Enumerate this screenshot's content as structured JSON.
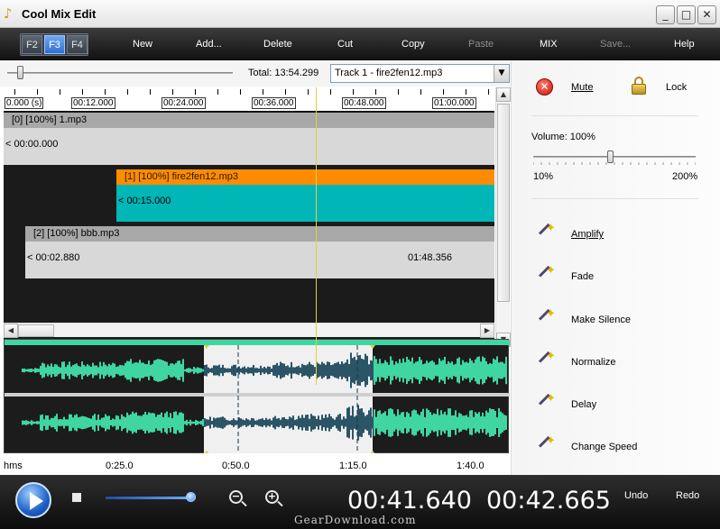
{
  "window": {
    "title": "Cool Mix Edit",
    "minimize": "_",
    "maximize": "□",
    "close": "✕"
  },
  "fkeys": [
    "F2",
    "F3",
    "F4"
  ],
  "menu": {
    "new": "New",
    "add": "Add...",
    "delete": "Delete",
    "cut": "Cut",
    "copy": "Copy",
    "paste": "Paste",
    "mix": "MIX",
    "save": "Save...",
    "help": "Help"
  },
  "toolbar": {
    "total": "Total: 13:54.299",
    "track_select": "Track 1 - fire2fen12.mp3"
  },
  "ruler": [
    "0.000 (s)",
    "00:12.000",
    "00:24.000",
    "00:36.000",
    "00:48.000",
    "01:00.000"
  ],
  "tracks": [
    {
      "header": "[0] [100%] 1.mp3",
      "start": "< 00:00.000",
      "end": ""
    },
    {
      "header": "[1] [100%] fire2fen12.mp3",
      "start": "< 00:15.000",
      "end": ""
    },
    {
      "header": "[2] [100%] bbb.mp3",
      "start": "< 00:02.880",
      "end": "01:48.356"
    }
  ],
  "wave_ruler": [
    "hms",
    "0:25.0",
    "0:50.0",
    "1:15.0",
    "1:40.0"
  ],
  "right_panel": {
    "mute": "Mute",
    "lock": "Lock",
    "volume": "Volume: 100%",
    "volume_min": "10%",
    "volume_max": "200%",
    "volume_level_percent": 100,
    "effects": [
      "Amplify",
      "Fade",
      "Make Silence",
      "Normalize",
      "Delay",
      "Change Speed"
    ]
  },
  "transport": {
    "current_time": "00:41.640",
    "end_time": "00:42.665",
    "undo": "Undo",
    "redo": "Redo",
    "zoom_out": "−",
    "zoom_in": "+"
  },
  "watermark": "GearDownload.com",
  "colors": {
    "selected_track_header": "#ff8c00",
    "selected_track_body": "#00b6b6",
    "waveform": "#3fd6a2",
    "playhead": "#e0d040"
  },
  "icons": [
    "mute-icon",
    "lock-icon",
    "magic-wand-icon",
    "play-icon",
    "stop-icon",
    "zoom-out-icon",
    "zoom-in-icon"
  ]
}
